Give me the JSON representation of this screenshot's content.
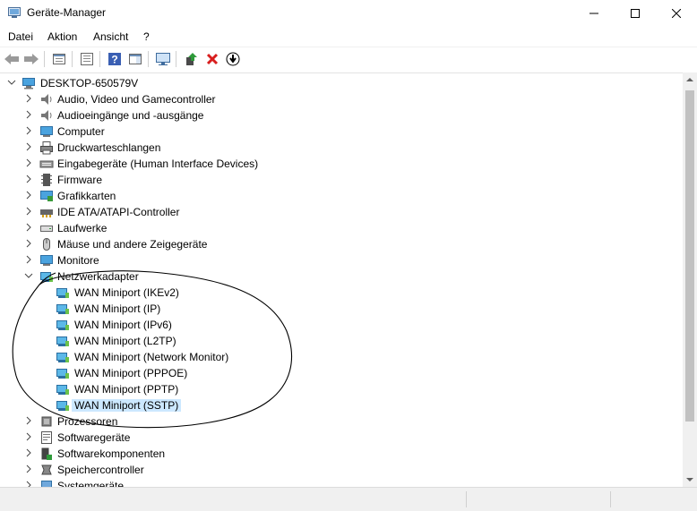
{
  "window": {
    "title": "Geräte-Manager"
  },
  "menu": {
    "items": [
      "Datei",
      "Aktion",
      "Ansicht",
      "?"
    ]
  },
  "toolbar": {
    "buttons": [
      "back-arrow-icon",
      "forward-arrow-icon",
      "properties-icon",
      "list-icon",
      "help-icon",
      "action-pane-icon",
      "monitor-icon",
      "update-driver-icon",
      "uninstall-icon",
      "download-icon"
    ]
  },
  "tree": {
    "root": "DESKTOP-650579V",
    "categories": [
      "Audio, Video und Gamecontroller",
      "Audioeingänge und -ausgänge",
      "Computer",
      "Druckwarteschlangen",
      "Eingabegeräte (Human Interface Devices)",
      "Firmware",
      "Grafikkarten",
      "IDE ATA/ATAPI-Controller",
      "Laufwerke",
      "Mäuse und andere Zeigegeräte",
      "Monitore",
      "Netzwerkadapter"
    ],
    "network_adapters": [
      "WAN Miniport (IKEv2)",
      "WAN Miniport (IP)",
      "WAN Miniport (IPv6)",
      "WAN Miniport (L2TP)",
      "WAN Miniport (Network Monitor)",
      "WAN Miniport (PPPOE)",
      "WAN Miniport (PPTP)",
      "WAN Miniport (SSTP)"
    ],
    "categories_after": [
      "Prozessoren",
      "Softwaregeräte",
      "Softwarekomponenten",
      "Speichercontroller",
      "Systemgeräte"
    ]
  },
  "colors": {
    "selection": "#cce8ff",
    "accent": "#0078d7"
  }
}
